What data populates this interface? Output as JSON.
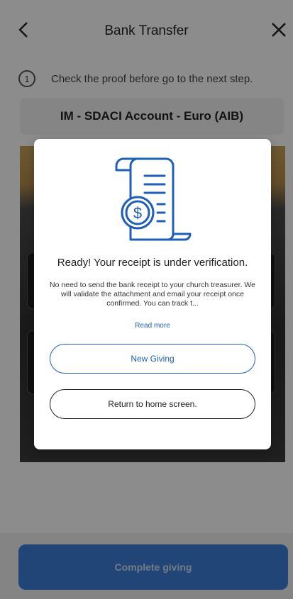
{
  "header": {
    "title": "Bank Transfer"
  },
  "step": {
    "number": "1",
    "text": "Check the proof before go to the next step."
  },
  "account": {
    "name": "IM - SDACI Account - Euro (AIB)"
  },
  "footer": {
    "complete_label": "Complete giving"
  },
  "modal": {
    "title": "Ready! Your receipt is under verification.",
    "body": "No need to send the bank receipt to your church treasurer. We will validate the attachment and email your receipt once confirmed. You can track t...",
    "read_more": "Read more",
    "new_giving_label": "New Giving",
    "return_home_label": "Return to home screen."
  },
  "icons": {
    "back": "chevron-left-icon",
    "close": "close-icon",
    "receipt": "receipt-dollar-icon"
  },
  "colors": {
    "accent": "#1f5fb8",
    "primary_button": "#3b7ed8"
  }
}
